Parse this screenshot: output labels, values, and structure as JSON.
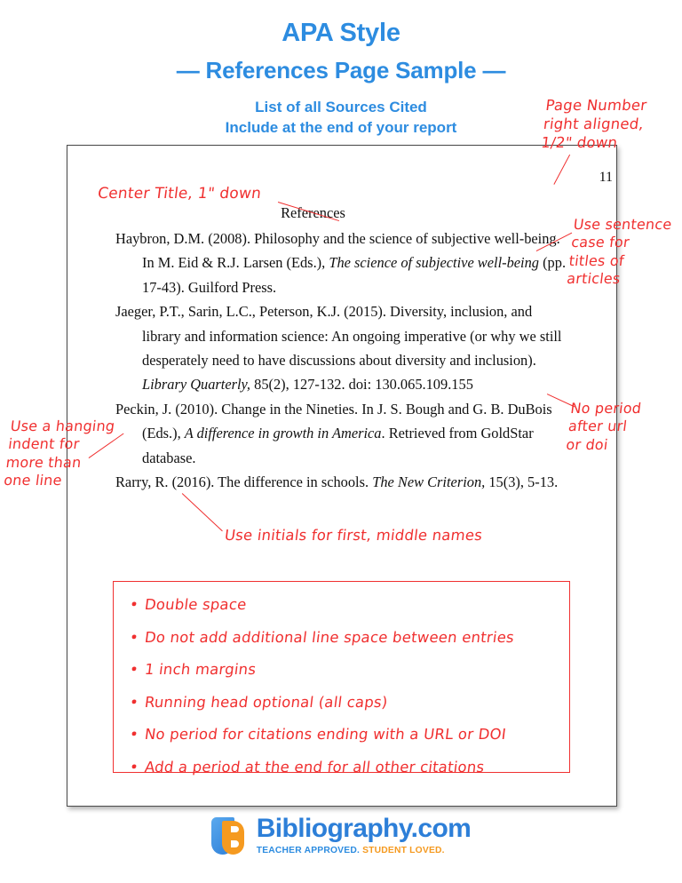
{
  "header": {
    "title_main": "APA Style",
    "title_sub": "—  References Page Sample  —",
    "subtitle_line1": "List of all Sources Cited",
    "subtitle_line2": "Include at the end of your report",
    "accent_color": "#2d8ce0"
  },
  "document": {
    "page_number": "11",
    "heading": "References",
    "references": [
      {
        "id": "haybron-2008",
        "parts": [
          {
            "text": "Haybron, D.M. (2008). Philosophy and the science of subjective well-being. In M. Eid & R.J. Larsen (Eds.), ",
            "italic": false
          },
          {
            "text": "The science of subjective well-being",
            "italic": true
          },
          {
            "text": " (pp. 17-43). Guilford Press.",
            "italic": false
          }
        ]
      },
      {
        "id": "jaeger-2015",
        "parts": [
          {
            "text": "Jaeger, P.T., Sarin, L.C., Peterson, K.J. (2015). Diversity, inclusion, and library and information science: An ongoing imperative (or why we still desperately need to have discussions about diversity and inclusion). ",
            "italic": false
          },
          {
            "text": "Library Quarterly,",
            "italic": true
          },
          {
            "text": " 85(2), 127-132. doi: 130.065.109.155",
            "italic": false
          }
        ]
      },
      {
        "id": "peckin-2010",
        "parts": [
          {
            "text": "Peckin, J. (2010). Change in the Nineties. In J. S. Bough and G. B. DuBois (Eds.), ",
            "italic": false
          },
          {
            "text": "A difference in growth in America",
            "italic": true
          },
          {
            "text": ". Retrieved from GoldStar database.",
            "italic": false
          }
        ]
      },
      {
        "id": "rarry-2016",
        "parts": [
          {
            "text": "Rarry, R. (2016). The difference in schools. ",
            "italic": false
          },
          {
            "text": "The New Criterion,",
            "italic": true
          },
          {
            "text": " 15(3), 5-13.",
            "italic": false
          }
        ]
      }
    ]
  },
  "annotations": {
    "color": "#f03030",
    "page_number": "Page Number\nright aligned,\n1/2\" down",
    "center_title": "Center Title, 1\" down",
    "sentence_case": "Use sentence\ncase for\ntitles of\narticles",
    "no_period": "No period\nafter url\nor doi",
    "hanging_indent": "Use a hanging\nindent for\nmore than\none line",
    "initials": "Use initials for first, middle names"
  },
  "rules_box": {
    "bullet": "•",
    "items": [
      "Double space",
      "Do not add additional line space between entries",
      "1 inch margins",
      "Running head optional (all caps)",
      "No period for citations ending with a URL or DOI",
      "Add a period at the end for all other citations"
    ]
  },
  "footer": {
    "brand_name": "Bibliography.com",
    "tagline_blue": "TEACHER APPROVED.",
    "tagline_orange": " STUDENT LOVED.",
    "brand_blue": "#2d7fd8",
    "brand_orange": "#f59a20"
  }
}
